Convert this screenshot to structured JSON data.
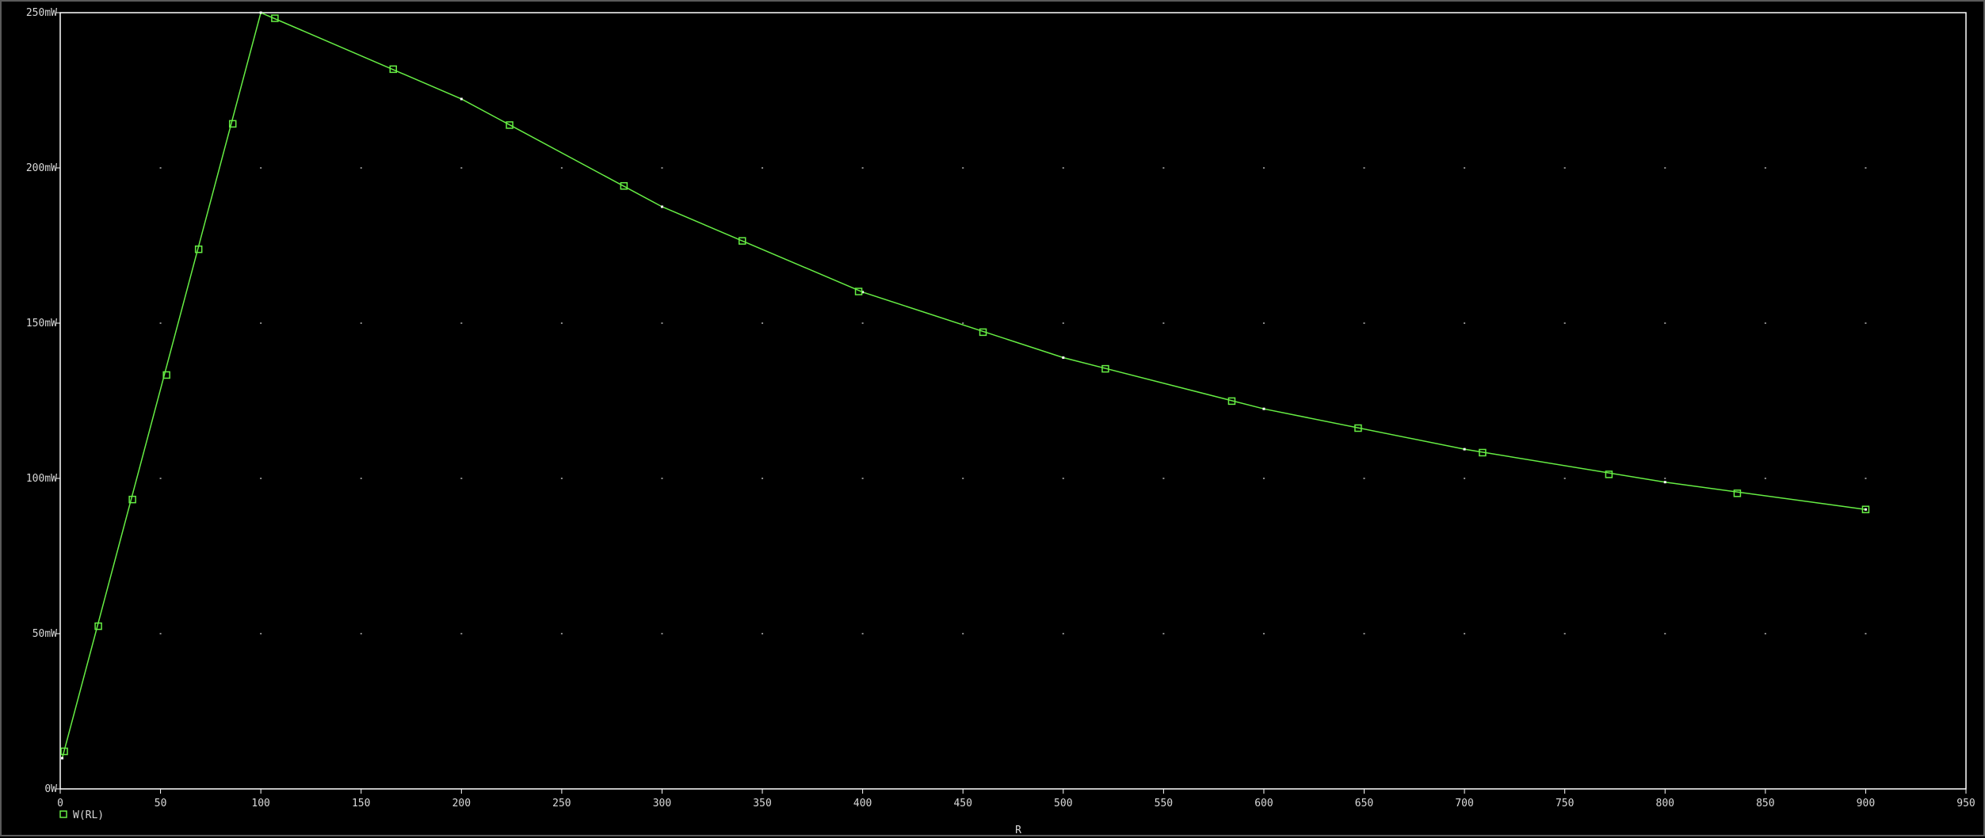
{
  "colors": {
    "background": "#000000",
    "frame": "#ffffff",
    "grid_dot": "#8a8a8a",
    "tick_text": "#d8d8d8",
    "series": "#66ee44",
    "point_dot": "#ffffff"
  },
  "chart_data": {
    "type": "line",
    "title": "",
    "xlabel": "R",
    "ylabel": "",
    "xlim": [
      0,
      950
    ],
    "ylim": [
      0,
      250
    ],
    "grid": "dotted",
    "legend_position": "bottom-left",
    "x_ticks": [
      0,
      50,
      100,
      150,
      200,
      250,
      300,
      350,
      400,
      450,
      500,
      550,
      600,
      650,
      700,
      750,
      800,
      850,
      900,
      950
    ],
    "x_tick_labels": [
      "0",
      "50",
      "100",
      "150",
      "200",
      "250",
      "300",
      "350",
      "400",
      "450",
      "500",
      "550",
      "600",
      "650",
      "700",
      "750",
      "800",
      "850",
      "900",
      "950"
    ],
    "y_ticks": [
      0,
      50,
      100,
      150,
      200,
      250
    ],
    "y_tick_labels": [
      "0W",
      "50mW",
      "100mW",
      "150mW",
      "200mW",
      "250mW"
    ],
    "series": [
      {
        "name": "W(RL)",
        "marker": "square",
        "x": [
          1,
          100,
          200,
          300,
          400,
          500,
          600,
          700,
          800,
          900
        ],
        "y": [
          9.9,
          250,
          222.2,
          187.5,
          160,
          138.9,
          122.4,
          109.4,
          98.8,
          90
        ],
        "marker_x": [
          2,
          19,
          36,
          53,
          69,
          86,
          107,
          166,
          224,
          281,
          340,
          398,
          460,
          521,
          584,
          647,
          709,
          772,
          836,
          900
        ],
        "marker_y": [
          12.1,
          52.4,
          93.2,
          133.3,
          173.8,
          214.2,
          248.2,
          231.8,
          213.8,
          194.2,
          176.5,
          160.2,
          147.1,
          135.3,
          124.9,
          116.2,
          108.3,
          101.3,
          95.2,
          90
        ]
      }
    ]
  }
}
